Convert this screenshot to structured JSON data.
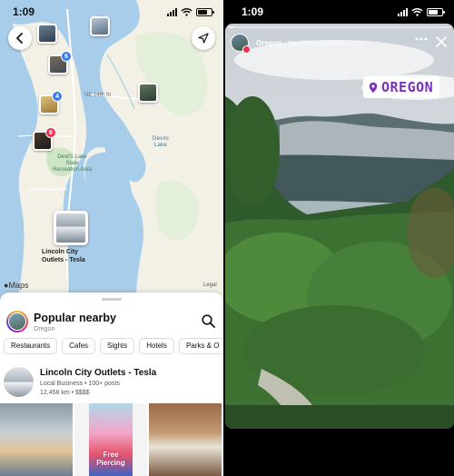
{
  "left": {
    "status": {
      "time": "1:09"
    },
    "map": {
      "maps_logo": "Maps",
      "legal": "Legal",
      "pins": [
        {
          "badge": ""
        },
        {
          "badge": ""
        },
        {
          "badge": "6"
        },
        {
          "badge": "4"
        },
        {
          "badge": ""
        },
        {
          "badge": "8"
        }
      ],
      "labels": {
        "devils_lake": "Devils\nLake",
        "state_park": "Devil's Lake\nState\nRecreation Area",
        "road_ne": "NE 14th St"
      },
      "featured_pin_label": "Lincoln City\nOutlets - Tesla"
    },
    "sheet": {
      "title": "Popular nearby",
      "subtitle": "Oregon",
      "chips": [
        "Restaurants",
        "Cafes",
        "Sights",
        "Hotels",
        "Parks & O"
      ],
      "place": {
        "name": "Lincoln City Outlets - Tesla",
        "meta1": "Local Business • 100+ posts",
        "meta2": "12,458 km • $$$$"
      },
      "photo_caption": "Free\nPiercing"
    }
  },
  "right": {
    "status": {
      "time": "1:09"
    },
    "story": {
      "location": "Oregon",
      "username": "thevictoriadanelle",
      "time_ago": "21h",
      "tag": "OREGON",
      "progress": 0.02
    }
  }
}
